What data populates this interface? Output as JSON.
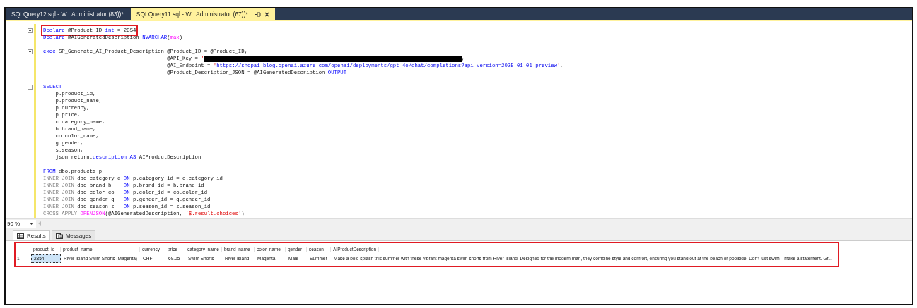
{
  "tabs": [
    {
      "label": "SQLQuery12.sql - W...Administrator (83))*",
      "selected": false
    },
    {
      "label": "SQLQuery11.sql - W...Administrator (67))*",
      "selected": true
    }
  ],
  "code": {
    "lines": [
      {
        "fold": true,
        "highlighted": true,
        "tokens": [
          {
            "kind": "kw",
            "text": "Declare"
          },
          {
            "kind": "plain",
            "text": " @Product_ID "
          },
          {
            "kind": "kw",
            "text": "int"
          },
          {
            "kind": "plain",
            "text": " = 2354"
          }
        ]
      },
      {
        "fold": false,
        "highlighted": false,
        "tokens": [
          {
            "kind": "kw",
            "text": "Declare"
          },
          {
            "kind": "plain",
            "text": " @AIGeneratedDescription "
          },
          {
            "kind": "kw",
            "text": "NVARCHAR"
          },
          {
            "kind": "plain",
            "text": "("
          },
          {
            "kind": "fn",
            "text": "max"
          },
          {
            "kind": "plain",
            "text": ")"
          }
        ]
      },
      {
        "fold": false,
        "highlighted": false
      },
      {
        "fold": true,
        "highlighted": false,
        "tokens": [
          {
            "kind": "kw",
            "text": "exec"
          },
          {
            "kind": "plain",
            "text": " SP_Generate_AI_Product_Description @Product_ID = @Product_ID,"
          }
        ]
      },
      {
        "fold": false,
        "highlighted": false,
        "tokens": [
          {
            "kind": "plain",
            "text": "                                        @API_Key = "
          },
          {
            "kind": "str",
            "text": "'"
          },
          {
            "kind": "redacted"
          },
          {
            "kind": "plain",
            "text": ","
          }
        ]
      },
      {
        "fold": false,
        "highlighted": false,
        "tokens": [
          {
            "kind": "plain",
            "text": "                                        @AI_Endpoint = "
          },
          {
            "kind": "str",
            "text": "'"
          },
          {
            "kind": "link",
            "text": "https://shopai-blog.openai.azure.com/openai/deployments/gpt-4o/chat/completions?api-version=2025-01-01-preview"
          },
          {
            "kind": "str",
            "text": "'"
          },
          {
            "kind": "plain",
            "text": ","
          }
        ]
      },
      {
        "fold": false,
        "highlighted": false,
        "tokens": [
          {
            "kind": "plain",
            "text": "                                        @Product_Description_JSON = @AIGeneratedDescription "
          },
          {
            "kind": "kw",
            "text": "OUTPUT"
          }
        ]
      },
      {
        "fold": false,
        "highlighted": false
      },
      {
        "fold": true,
        "highlighted": false,
        "tokens": [
          {
            "kind": "kw",
            "text": "SELECT"
          }
        ]
      },
      {
        "fold": false,
        "highlighted": false,
        "tokens": [
          {
            "kind": "plain",
            "text": "    p.product_id,"
          }
        ]
      },
      {
        "fold": false,
        "highlighted": false,
        "tokens": [
          {
            "kind": "plain",
            "text": "    p.product_name,"
          }
        ]
      },
      {
        "fold": false,
        "highlighted": false,
        "tokens": [
          {
            "kind": "plain",
            "text": "    p.currency,"
          }
        ]
      },
      {
        "fold": false,
        "highlighted": false,
        "tokens": [
          {
            "kind": "plain",
            "text": "    p.price,"
          }
        ]
      },
      {
        "fold": false,
        "highlighted": false,
        "tokens": [
          {
            "kind": "plain",
            "text": "    c.category_name,"
          }
        ]
      },
      {
        "fold": false,
        "highlighted": false,
        "tokens": [
          {
            "kind": "plain",
            "text": "    b.brand_name,"
          }
        ]
      },
      {
        "fold": false,
        "highlighted": false,
        "tokens": [
          {
            "kind": "plain",
            "text": "    co.color_name,"
          }
        ]
      },
      {
        "fold": false,
        "highlighted": false,
        "tokens": [
          {
            "kind": "plain",
            "text": "    g.gender,"
          }
        ]
      },
      {
        "fold": false,
        "highlighted": false,
        "tokens": [
          {
            "kind": "plain",
            "text": "    s.season,"
          }
        ]
      },
      {
        "fold": false,
        "highlighted": false,
        "tokens": [
          {
            "kind": "plain",
            "text": "    json_return."
          },
          {
            "kind": "kw",
            "text": "description"
          },
          {
            "kind": "kw",
            "text": " AS"
          },
          {
            "kind": "plain",
            "text": " AIProductDescription"
          }
        ]
      },
      {
        "fold": false,
        "highlighted": false
      },
      {
        "fold": false,
        "highlighted": false,
        "tokens": [
          {
            "kind": "kw",
            "text": "FROM"
          },
          {
            "kind": "plain",
            "text": " dbo.products p"
          }
        ]
      },
      {
        "fold": false,
        "highlighted": false,
        "tokens": [
          {
            "kind": "gray",
            "text": "INNER JOIN"
          },
          {
            "kind": "plain",
            "text": " dbo.category c "
          },
          {
            "kind": "kw",
            "text": "ON"
          },
          {
            "kind": "plain",
            "text": " p.category_id = c.category_id"
          }
        ]
      },
      {
        "fold": false,
        "highlighted": false,
        "tokens": [
          {
            "kind": "gray",
            "text": "INNER JOIN"
          },
          {
            "kind": "plain",
            "text": " dbo.brand b    "
          },
          {
            "kind": "kw",
            "text": "ON"
          },
          {
            "kind": "plain",
            "text": " p.brand_id = b.brand_id"
          }
        ]
      },
      {
        "fold": false,
        "highlighted": false,
        "tokens": [
          {
            "kind": "gray",
            "text": "INNER JOIN"
          },
          {
            "kind": "plain",
            "text": " dbo.color co   "
          },
          {
            "kind": "kw",
            "text": "ON"
          },
          {
            "kind": "plain",
            "text": " p.color_id = co.color_id"
          }
        ]
      },
      {
        "fold": false,
        "highlighted": false,
        "tokens": [
          {
            "kind": "gray",
            "text": "INNER JOIN"
          },
          {
            "kind": "plain",
            "text": " dbo.gender g   "
          },
          {
            "kind": "kw",
            "text": "ON"
          },
          {
            "kind": "plain",
            "text": " p.gender_id = g.gender_id"
          }
        ]
      },
      {
        "fold": false,
        "highlighted": false,
        "tokens": [
          {
            "kind": "gray",
            "text": "INNER JOIN"
          },
          {
            "kind": "plain",
            "text": " dbo.season s   "
          },
          {
            "kind": "kw",
            "text": "ON"
          },
          {
            "kind": "plain",
            "text": " p.season_id = s.season_id"
          }
        ]
      },
      {
        "fold": false,
        "highlighted": false,
        "tokens": [
          {
            "kind": "gray",
            "text": "CROSS APPLY "
          },
          {
            "kind": "fn",
            "text": "OPENJSON"
          },
          {
            "kind": "plain",
            "text": "(@AIGeneratedDescription, "
          },
          {
            "kind": "str",
            "text": "'$.result.choices'"
          },
          {
            "kind": "plain",
            "text": ")"
          }
        ]
      }
    ]
  },
  "zoom": {
    "value": "90 %"
  },
  "result_tabs": [
    {
      "label": "Results",
      "selected": true
    },
    {
      "label": "Messages",
      "selected": false
    }
  ],
  "grid": {
    "highlighted": true,
    "columns": [
      "product_id",
      "product_name",
      "currency",
      "price",
      "category_name",
      "brand_name",
      "color_name",
      "gender",
      "season",
      "AIProductDescription"
    ],
    "rows": [
      {
        "number": "1",
        "cells": [
          {
            "text": "2354",
            "selected": true
          },
          {
            "text": "River Island Swim Shorts (Magenta)",
            "selected": false
          },
          {
            "text": "CHF",
            "selected": false
          },
          {
            "text": "69.05",
            "selected": false
          },
          {
            "text": "Swim Shorts",
            "selected": false
          },
          {
            "text": "River Island",
            "selected": false
          },
          {
            "text": "Magenta",
            "selected": false
          },
          {
            "text": "Male",
            "selected": false
          },
          {
            "text": "Summer",
            "selected": false
          },
          {
            "text": "Make a bold splash this summer with these vibrant magenta swim shorts from River Island. Designed for the modern man, they combine style and comfort, ensuring you stand out at the beach or poolside. Don't just swim—make a statement. Gr...",
            "selected": false
          }
        ]
      }
    ]
  }
}
